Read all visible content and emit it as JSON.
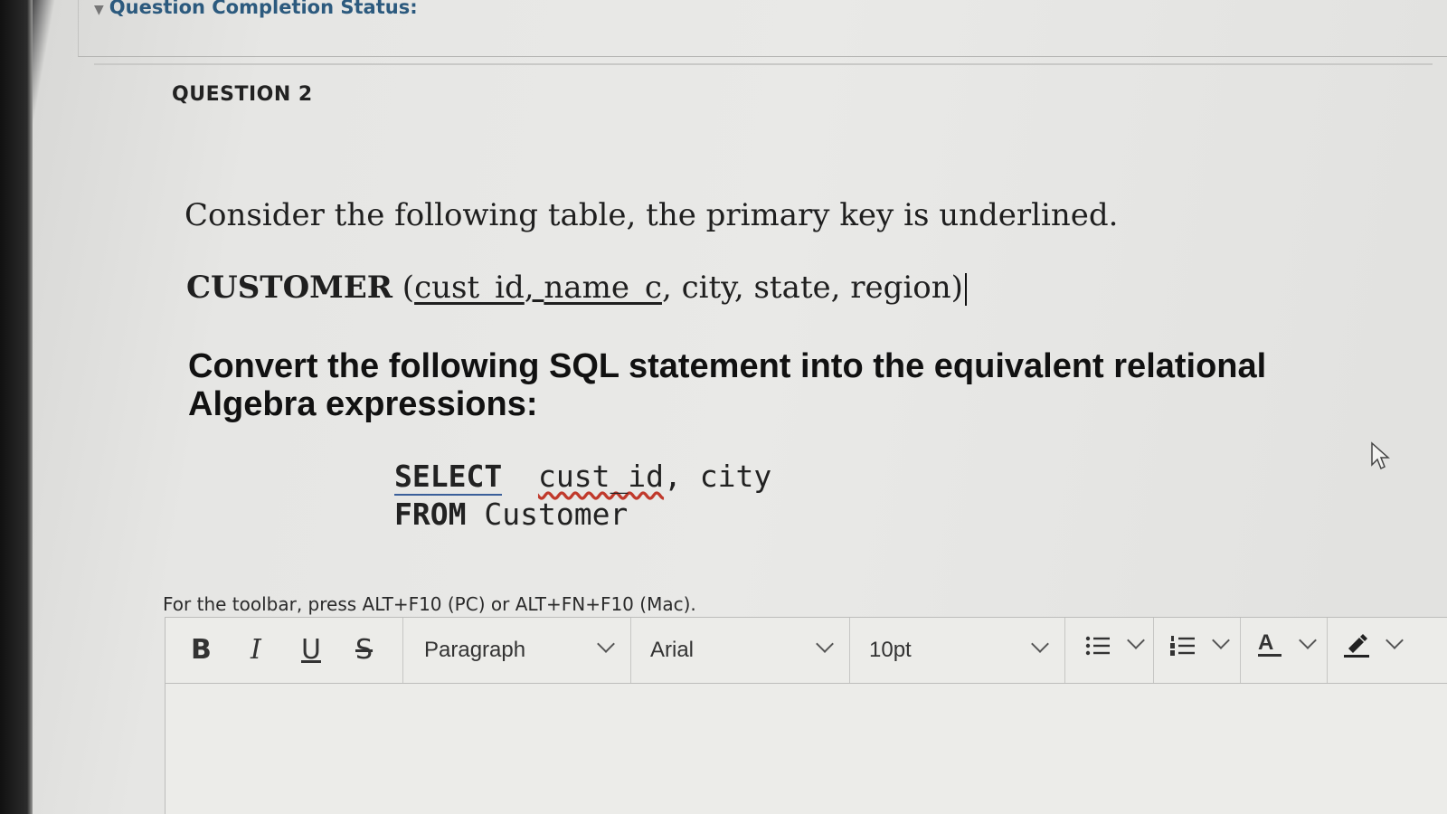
{
  "status": {
    "label": "Question Completion Status:"
  },
  "question": {
    "title": "QUESTION 2",
    "intro": "Consider the following table, the primary key is underlined.",
    "schema": {
      "table_name": "CUSTOMER",
      "open_paren": " (",
      "pk1": "cust_id",
      "sep1": ", ",
      "pk2": "name_c",
      "rest": ", city, state, region)"
    },
    "instruction": "Convert the following SQL statement into the equivalent relational Algebra expressions:",
    "sql": {
      "select_kw": "SELECT",
      "select_cols_a": "cust_id",
      "select_cols_b": ", city",
      "from_kw": "FROM",
      "from_table": "Customer"
    }
  },
  "editor": {
    "toolbar_hint": "For the toolbar, press ALT+F10 (PC) or ALT+FN+F10 (Mac).",
    "bold_label": "B",
    "italic_label": "I",
    "underline_label": "U",
    "strike_label": "S",
    "paragraph_value": "Paragraph",
    "font_value": "Arial",
    "size_value": "10pt",
    "text_color_label": "A"
  }
}
